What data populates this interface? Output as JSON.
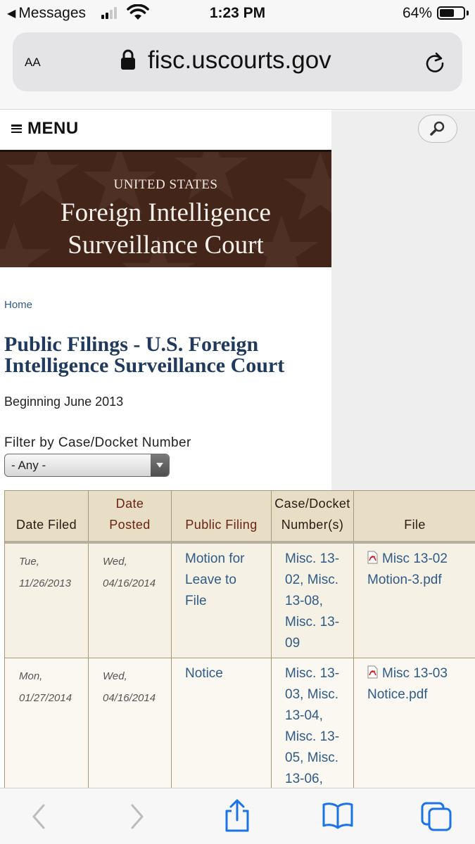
{
  "status_bar": {
    "back_app": "Messages",
    "time": "1:23 PM",
    "battery_pct": "64%",
    "battery_level": 0.64
  },
  "url_bar": {
    "text_size_label": "AA",
    "domain": "fisc.uscourts.gov"
  },
  "site": {
    "menu_label": "MENU",
    "banner": {
      "small": "UNITED STATES",
      "line1": "Foreign Intelligence",
      "line2": "Surveillance Court"
    },
    "breadcrumb": "Home",
    "title_line1": "Public Filings - U.S. Foreign",
    "title_line2": "Intelligence Surveillance Court",
    "subtitle": "Beginning June 2013",
    "filter": {
      "label": "Filter by Case/Docket Number",
      "value": "- Any -"
    },
    "table": {
      "headers": {
        "date_filed": "Date Filed",
        "date_posted_1": "Date",
        "date_posted_2": "Posted",
        "public_filing": "Public Filing",
        "case_1": "Case/Docket",
        "case_2": "Number(s)",
        "file": "File"
      },
      "rows": [
        {
          "filed_day": "Tue,",
          "filed_date": "11/26/2013",
          "posted_day": "Wed,",
          "posted_date": "04/16/2014",
          "filing_lines": [
            "Motion for",
            "Leave to",
            "File"
          ],
          "case_lines": [
            "Misc. 13-",
            "02, Misc.",
            "13-08,",
            "Misc. 13-",
            "09"
          ],
          "file_lines": [
            "Misc 13-02",
            "Motion-3.pdf"
          ]
        },
        {
          "filed_day": "Mon,",
          "filed_date": "01/27/2014",
          "posted_day": "Wed,",
          "posted_date": "04/16/2014",
          "filing_lines": [
            "Notice"
          ],
          "case_lines": [
            "Misc. 13-",
            "03, Misc.",
            "13-04,",
            "Misc. 13-",
            "05, Misc.",
            "13-06,"
          ],
          "file_lines": [
            "Misc 13-03",
            "Notice.pdf"
          ]
        }
      ]
    }
  },
  "colors": {
    "banner_bg": "#43251a",
    "link": "#2f5b87",
    "title": "#1f3a5c",
    "table_header_bg": "#e8ddc5",
    "header_text": "#6b2316"
  },
  "icons": {
    "search": "magnifier-icon",
    "pdf": "pdf-icon",
    "reload": "reload-icon",
    "lock": "lock-icon",
    "share": "share-icon",
    "bookmarks": "book-icon",
    "tabs": "tabs-icon"
  }
}
